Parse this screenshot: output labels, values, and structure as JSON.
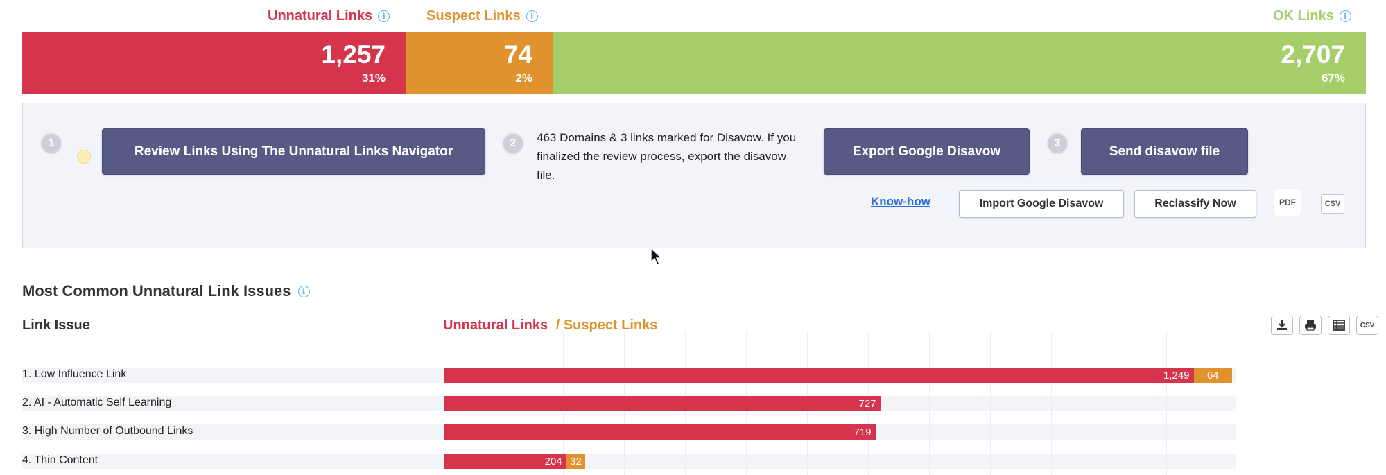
{
  "colors": {
    "unnatural": "#d6334d",
    "suspect": "#e0922f",
    "ok": "#a6cf6b"
  },
  "summary": {
    "unnatural": {
      "label": "Unnatural Links",
      "count": "1,257",
      "percent": "31%",
      "share": 31
    },
    "suspect": {
      "label": "Suspect Links",
      "count": "74",
      "percent": "2%",
      "share": 2
    },
    "ok": {
      "label": "OK Links",
      "count": "2,707",
      "percent": "67%",
      "share": 67
    }
  },
  "actions": {
    "step1": "1",
    "step2": "2",
    "step3": "3",
    "review_button": "Review Links Using The Unnatural Links Navigator",
    "disavow_text": "463 Domains & 3 links marked for Disavow. If you finalized the review process, export the disavow file.",
    "export_button": "Export Google Disavow",
    "send_button": "Send disavow file",
    "know_how": "Know-how",
    "import_button": "Import Google Disavow",
    "reclassify_button": "Reclassify Now",
    "pdf": "PDF",
    "csv": "CSV"
  },
  "section": {
    "title": "Most Common Unnatural Link Issues",
    "column_issue": "Link Issue",
    "legend_unnatural": "Unnatural Links",
    "legend_suspect": "/ Suspect Links",
    "toolbar": {
      "download_icon": "download-icon",
      "print_icon": "print-icon",
      "table_icon": "table-icon",
      "csv": "CSV"
    }
  },
  "chart_data": {
    "type": "bar",
    "orientation": "horizontal",
    "stacked": true,
    "categories": [
      "1. Low Influence Link",
      "2. AI - Automatic Self Learning",
      "3. High Number of Outbound Links",
      "4. Thin Content"
    ],
    "series": [
      {
        "name": "Unnatural Links",
        "values": [
          1249,
          727,
          719,
          204
        ],
        "labels": [
          "1,249",
          "727",
          "719",
          "204"
        ]
      },
      {
        "name": "Suspect Links",
        "values": [
          64,
          0,
          0,
          32
        ],
        "labels": [
          "64",
          "",
          "",
          "32"
        ]
      }
    ],
    "xlim": [
      0,
      1320
    ]
  }
}
